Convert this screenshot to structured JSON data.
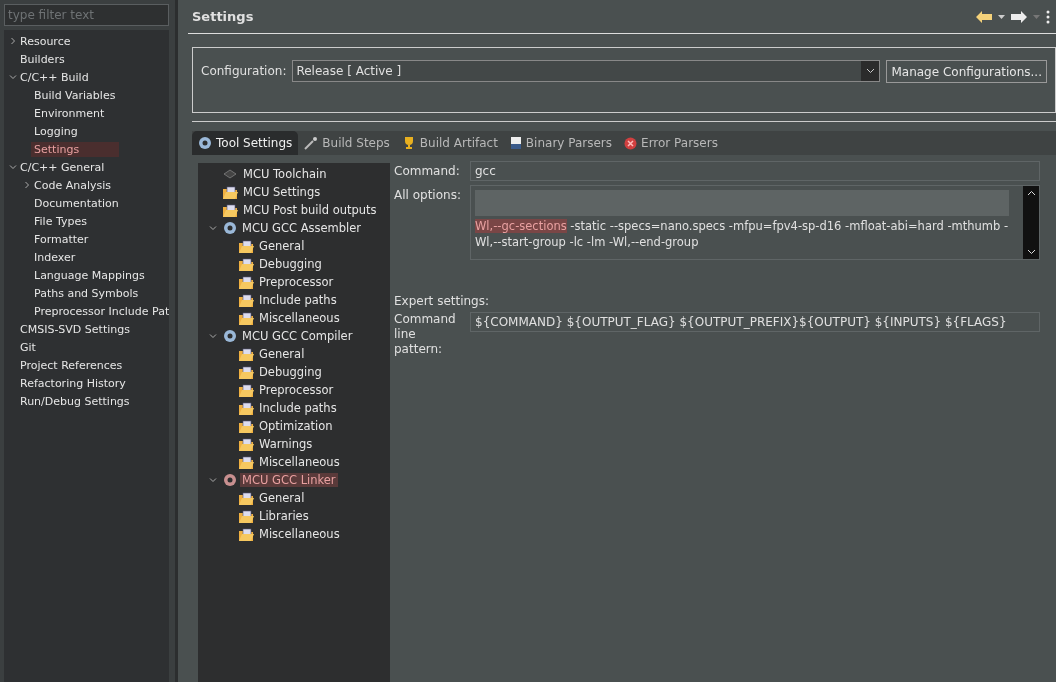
{
  "sidebar": {
    "filter": {
      "placeholder": "type filter text"
    },
    "items": [
      {
        "label": "Resource",
        "expanded": false,
        "selected": false
      },
      {
        "label": "Builders",
        "selected": false
      },
      {
        "label": "C/C++ Build",
        "expanded": true,
        "selected": false,
        "children": [
          {
            "label": "Build Variables",
            "selected": false
          },
          {
            "label": "Environment",
            "selected": false
          },
          {
            "label": "Logging",
            "selected": false
          },
          {
            "label": "Settings",
            "selected": true
          }
        ]
      },
      {
        "label": "C/C++ General",
        "expanded": true,
        "selected": false,
        "children": [
          {
            "label": "Code Analysis",
            "expanded": false,
            "selected": false
          },
          {
            "label": "Documentation",
            "selected": false
          },
          {
            "label": "File Types",
            "selected": false
          },
          {
            "label": "Formatter",
            "selected": false
          },
          {
            "label": "Indexer",
            "selected": false
          },
          {
            "label": "Language Mappings",
            "selected": false
          },
          {
            "label": "Paths and Symbols",
            "selected": false
          },
          {
            "label": "Preprocessor Include Pat",
            "selected": false
          }
        ]
      },
      {
        "label": "CMSIS-SVD Settings",
        "selected": false
      },
      {
        "label": "Git",
        "selected": false
      },
      {
        "label": "Project References",
        "selected": false
      },
      {
        "label": "Refactoring History",
        "selected": false
      },
      {
        "label": "Run/Debug Settings",
        "selected": false
      }
    ]
  },
  "header": {
    "title": "Settings"
  },
  "configuration": {
    "label": "Configuration:",
    "value": "Release  [ Active ]",
    "button": "Manage Configurations..."
  },
  "tabs": [
    {
      "label": "Tool Settings",
      "selected": true,
      "kind": "tool"
    },
    {
      "label": "Build Steps",
      "selected": false,
      "kind": "steps"
    },
    {
      "label": "Build Artifact",
      "selected": false,
      "kind": "artifact"
    },
    {
      "label": "Binary Parsers",
      "selected": false,
      "kind": "binary"
    },
    {
      "label": "Error Parsers",
      "selected": false,
      "kind": "error"
    }
  ],
  "tool_tree": [
    {
      "label": "MCU Toolchain",
      "kind": "chip",
      "selected": false
    },
    {
      "label": "MCU Settings",
      "kind": "folder",
      "selected": false
    },
    {
      "label": "MCU Post build outputs",
      "kind": "folder",
      "selected": false
    },
    {
      "label": "MCU GCC Assembler",
      "kind": "tool",
      "expanded": true,
      "selected": false,
      "children": [
        {
          "label": "General",
          "kind": "folder",
          "selected": false
        },
        {
          "label": "Debugging",
          "kind": "folder",
          "selected": false
        },
        {
          "label": "Preprocessor",
          "kind": "folder",
          "selected": false
        },
        {
          "label": "Include paths",
          "kind": "folder",
          "selected": false
        },
        {
          "label": "Miscellaneous",
          "kind": "folder",
          "selected": false
        }
      ]
    },
    {
      "label": "MCU GCC Compiler",
      "kind": "tool",
      "expanded": true,
      "selected": false,
      "children": [
        {
          "label": "General",
          "kind": "folder",
          "selected": false
        },
        {
          "label": "Debugging",
          "kind": "folder",
          "selected": false
        },
        {
          "label": "Preprocessor",
          "kind": "folder",
          "selected": false
        },
        {
          "label": "Include paths",
          "kind": "folder",
          "selected": false
        },
        {
          "label": "Optimization",
          "kind": "folder",
          "selected": false
        },
        {
          "label": "Warnings",
          "kind": "folder",
          "selected": false
        },
        {
          "label": "Miscellaneous",
          "kind": "folder",
          "selected": false
        }
      ]
    },
    {
      "label": "MCU GCC Linker",
      "kind": "tool",
      "expanded": true,
      "selected": true,
      "children": [
        {
          "label": "General",
          "kind": "folder",
          "selected": false
        },
        {
          "label": "Libraries",
          "kind": "folder",
          "selected": false
        },
        {
          "label": "Miscellaneous",
          "kind": "folder",
          "selected": false
        }
      ]
    }
  ],
  "command": {
    "label": "Command:",
    "value": "gcc"
  },
  "all_options": {
    "label": "All options:",
    "highlight": "Wl,--gc-sections",
    "text": " -static --specs=nano.specs -mfpu=fpv4-sp-d16 -mfloat-abi=hard -mthumb -Wl,--start-group -lc -lm -Wl,--end-group"
  },
  "expert": {
    "heading": "Expert settings:",
    "label": "Command line pattern:",
    "value": "${COMMAND} ${OUTPUT_FLAG} ${OUTPUT_PREFIX}${OUTPUT} ${INPUTS} ${FLAGS}"
  }
}
